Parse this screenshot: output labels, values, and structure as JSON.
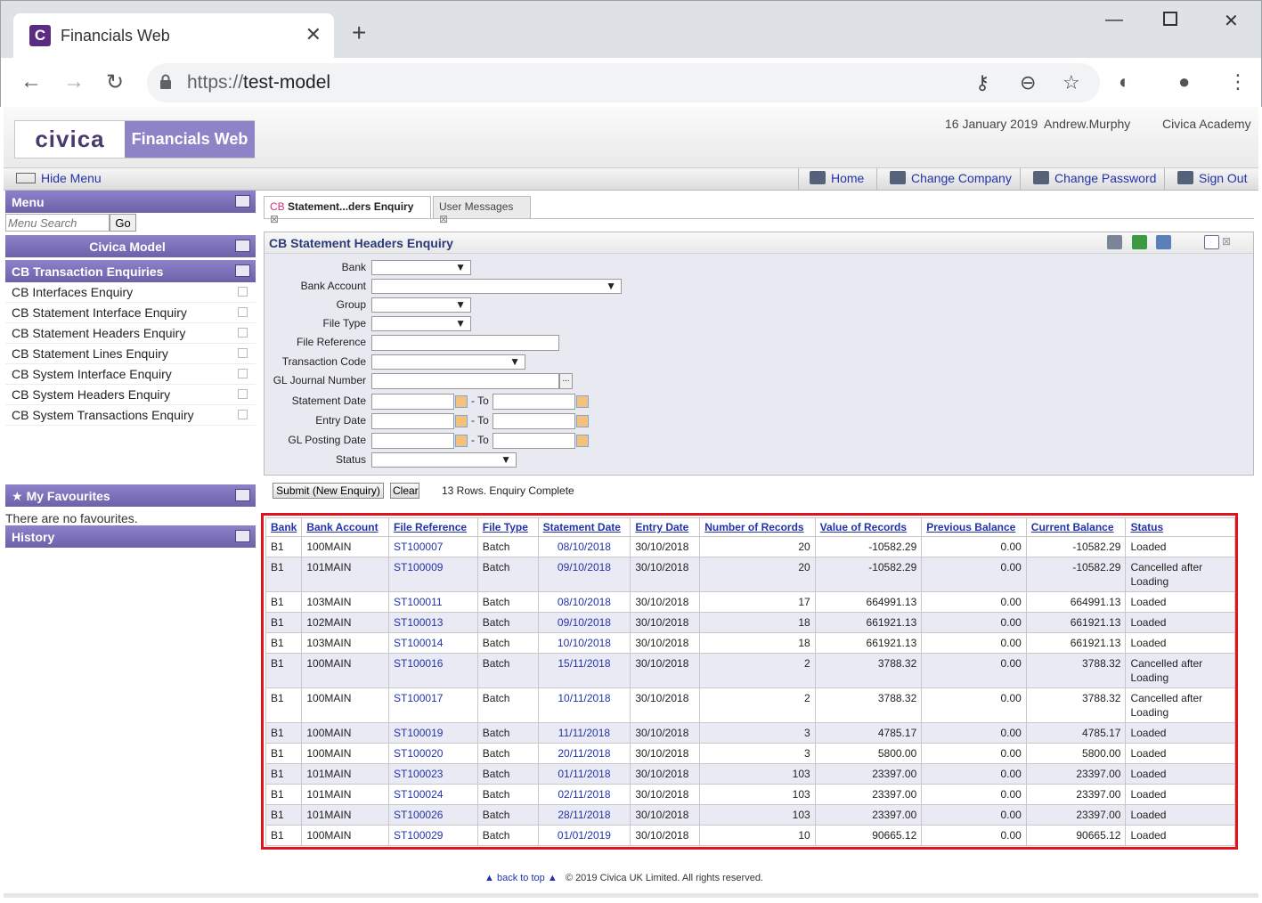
{
  "browser": {
    "tab_title": "Financials Web",
    "url_scheme": "https://",
    "url_host": "test-model",
    "colors": {
      "favicon": "#5b2c83"
    }
  },
  "header": {
    "logo_civica": "civica",
    "logo_product": "Financials Web",
    "date": "16 January 2019",
    "user": "Andrew.Murphy",
    "company": "Civica Academy"
  },
  "topbar": {
    "hide_menu": "Hide Menu",
    "home": "Home",
    "change_company": "Change Company",
    "change_password": "Change Password",
    "sign_out": "Sign Out"
  },
  "sidebar": {
    "menu_title": "Menu",
    "search_placeholder": "Menu Search",
    "go": "Go",
    "model_title": "Civica Model",
    "section_title": "CB Transaction Enquiries",
    "items": [
      "CB Interfaces Enquiry",
      "CB Statement Interface Enquiry",
      "CB Statement Headers Enquiry",
      "CB Statement Lines Enquiry",
      "CB System Interface Enquiry",
      "CB System Headers Enquiry",
      "CB System Transactions Enquiry"
    ],
    "favourites_title": "My Favourites",
    "favourites_note": "There are no favourites.",
    "history_title": "History"
  },
  "tabs": {
    "active_prefix": "CB",
    "active_label": "Statement...ders Enquiry",
    "inactive_label": "User Messages"
  },
  "form": {
    "title": "CB Statement Headers Enquiry",
    "labels": {
      "bank": "Bank",
      "bank_account": "Bank Account",
      "group": "Group",
      "file_type": "File Type",
      "file_reference": "File Reference",
      "transaction_code": "Transaction Code",
      "gl_journal_number": "GL Journal Number",
      "statement_date": "Statement Date",
      "entry_date": "Entry Date",
      "gl_posting_date": "GL Posting Date",
      "status": "Status",
      "to": "- To",
      "lookup": "..."
    },
    "submit": "Submit (New Enquiry)",
    "clear": "Clear",
    "result_msg": "13 Rows. Enquiry Complete"
  },
  "grid": {
    "columns": [
      "Bank",
      "Bank Account",
      "File Reference",
      "File Type",
      "Statement Date",
      "Entry Date",
      "Number of Records",
      "Value of Records",
      "Previous Balance",
      "Current Balance",
      "Status"
    ],
    "rows": [
      [
        "B1",
        "100MAIN",
        "ST100007",
        "Batch",
        "08/10/2018",
        "30/10/2018",
        "20",
        "-10582.29",
        "0.00",
        "-10582.29",
        "Loaded"
      ],
      [
        "B1",
        "101MAIN",
        "ST100009",
        "Batch",
        "09/10/2018",
        "30/10/2018",
        "20",
        "-10582.29",
        "0.00",
        "-10582.29",
        "Cancelled after Loading"
      ],
      [
        "B1",
        "103MAIN",
        "ST100011",
        "Batch",
        "08/10/2018",
        "30/10/2018",
        "17",
        "664991.13",
        "0.00",
        "664991.13",
        "Loaded"
      ],
      [
        "B1",
        "102MAIN",
        "ST100013",
        "Batch",
        "09/10/2018",
        "30/10/2018",
        "18",
        "661921.13",
        "0.00",
        "661921.13",
        "Loaded"
      ],
      [
        "B1",
        "103MAIN",
        "ST100014",
        "Batch",
        "10/10/2018",
        "30/10/2018",
        "18",
        "661921.13",
        "0.00",
        "661921.13",
        "Loaded"
      ],
      [
        "B1",
        "100MAIN",
        "ST100016",
        "Batch",
        "15/11/2018",
        "30/10/2018",
        "2",
        "3788.32",
        "0.00",
        "3788.32",
        "Cancelled after Loading"
      ],
      [
        "B1",
        "100MAIN",
        "ST100017",
        "Batch",
        "10/11/2018",
        "30/10/2018",
        "2",
        "3788.32",
        "0.00",
        "3788.32",
        "Cancelled after Loading"
      ],
      [
        "B1",
        "100MAIN",
        "ST100019",
        "Batch",
        "11/11/2018",
        "30/10/2018",
        "3",
        "4785.17",
        "0.00",
        "4785.17",
        "Loaded"
      ],
      [
        "B1",
        "100MAIN",
        "ST100020",
        "Batch",
        "20/11/2018",
        "30/10/2018",
        "3",
        "5800.00",
        "0.00",
        "5800.00",
        "Loaded"
      ],
      [
        "B1",
        "101MAIN",
        "ST100023",
        "Batch",
        "01/11/2018",
        "30/10/2018",
        "103",
        "23397.00",
        "0.00",
        "23397.00",
        "Loaded"
      ],
      [
        "B1",
        "101MAIN",
        "ST100024",
        "Batch",
        "02/11/2018",
        "30/10/2018",
        "103",
        "23397.00",
        "0.00",
        "23397.00",
        "Loaded"
      ],
      [
        "B1",
        "101MAIN",
        "ST100026",
        "Batch",
        "28/11/2018",
        "30/10/2018",
        "103",
        "23397.00",
        "0.00",
        "23397.00",
        "Loaded"
      ],
      [
        "B1",
        "100MAIN",
        "ST100029",
        "Batch",
        "01/01/2019",
        "30/10/2018",
        "10",
        "90665.12",
        "0.00",
        "90665.12",
        "Loaded"
      ]
    ]
  },
  "footer": {
    "back_to_top": "back to top",
    "copyright": "© 2019 Civica UK Limited. All rights reserved."
  },
  "colors": {
    "accent": "#8f83c8",
    "highlight_border": "#e0141e",
    "link": "#2233aa"
  }
}
